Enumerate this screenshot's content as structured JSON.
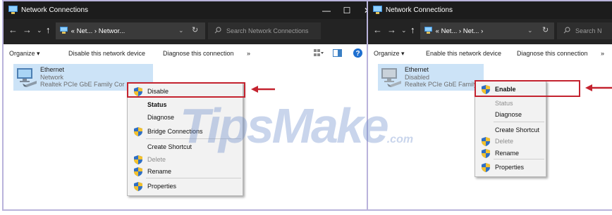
{
  "colors": {
    "accent_red": "#c4232f",
    "titlebar": "#1c1c1c",
    "selection": "#cce3f7"
  },
  "watermark": {
    "main": "TipsMake",
    "suffix": ".com"
  },
  "left": {
    "title": "Network Connections",
    "controls": {
      "minimize": "—",
      "maximize": "☐",
      "close": "✕"
    },
    "nav": {
      "back": "←",
      "forward": "→",
      "recent": "⌄",
      "up": "↑"
    },
    "breadcrumb": [
      "«",
      "Net...",
      "›",
      "Networ..."
    ],
    "search_placeholder": "Search Network Connections",
    "commands": {
      "organize": "Organize ▾",
      "device_action": "Disable this network device",
      "diagnose": "Diagnose this connection",
      "more": "»"
    },
    "connection": {
      "name": "Ethernet",
      "status": "Network",
      "adapter": "Realtek PCIe GbE Family Cor"
    },
    "menu": [
      {
        "label": "Disable",
        "icon": "shield-icon",
        "style": "normal",
        "highlighted": true
      },
      {
        "label": "Status",
        "icon": "",
        "style": "bold"
      },
      {
        "label": "Diagnose",
        "icon": "",
        "style": "normal"
      },
      {
        "label": "Bridge Connections",
        "icon": "shield-icon",
        "style": "normal"
      },
      {
        "label": "Create Shortcut",
        "icon": "",
        "style": "normal"
      },
      {
        "label": "Delete",
        "icon": "shield-icon",
        "style": "disabled"
      },
      {
        "label": "Rename",
        "icon": "shield-icon",
        "style": "normal"
      },
      {
        "label": "Properties",
        "icon": "shield-icon",
        "style": "normal"
      }
    ]
  },
  "right": {
    "title": "Network Connections",
    "nav": {
      "back": "←",
      "forward": "→",
      "recent": "⌄",
      "up": "↑"
    },
    "breadcrumb": [
      "«",
      "Net...",
      "›",
      "Net...",
      "›"
    ],
    "search_placeholder": "Search N",
    "commands": {
      "organize": "Organize ▾",
      "device_action": "Enable this network device",
      "diagnose": "Diagnose this connection",
      "more": "»"
    },
    "connection": {
      "name": "Ethernet",
      "status": "Disabled",
      "adapter": "Realtek PCIe GbE Family"
    },
    "menu": [
      {
        "label": "Enable",
        "icon": "shield-icon",
        "style": "bold",
        "highlighted": true
      },
      {
        "label": "Status",
        "icon": "",
        "style": "disabled"
      },
      {
        "label": "Diagnose",
        "icon": "",
        "style": "normal"
      },
      {
        "label": "Create Shortcut",
        "icon": "",
        "style": "normal"
      },
      {
        "label": "Delete",
        "icon": "shield-icon",
        "style": "disabled"
      },
      {
        "label": "Rename",
        "icon": "shield-icon",
        "style": "normal"
      },
      {
        "label": "Properties",
        "icon": "shield-icon",
        "style": "normal"
      }
    ]
  }
}
